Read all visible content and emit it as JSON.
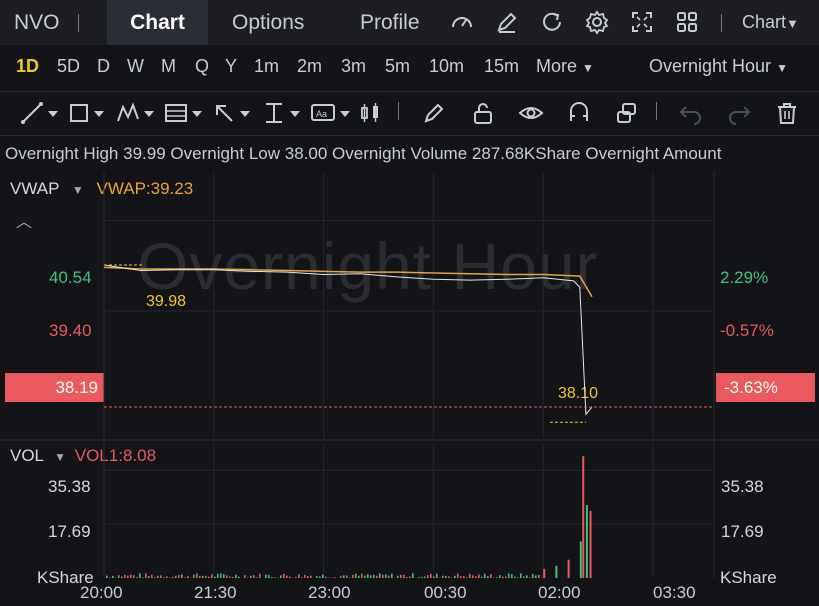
{
  "header": {
    "symbol": "NVO",
    "tabs": [
      "Chart",
      "Options",
      "Profile"
    ],
    "chart_menu": "Chart",
    "icons": [
      "speedometer-icon",
      "edit-icon",
      "refresh-icon",
      "settings-icon",
      "fullscreen-icon",
      "layout-grid-icon"
    ]
  },
  "timeframes": {
    "items": [
      "1D",
      "5D",
      "D",
      "W",
      "M",
      "Q",
      "Y",
      "1m",
      "2m",
      "3m",
      "5m",
      "10m",
      "15m"
    ],
    "more": "More",
    "session": "Overnight Hour",
    "active": "1D"
  },
  "info": {
    "high_label": "Overnight High",
    "high": "39.99",
    "low_label": "Overnight Low",
    "low": "38.00",
    "volume_label": "Overnight Volume",
    "volume": "287.68KShare",
    "amount_label": "Overnight Amount"
  },
  "price_panel": {
    "indicator": "VWAP",
    "indicator_value": "VWAP:39.23",
    "watermark": "Overnight Hour",
    "left_axis": [
      "40.54",
      "39.40",
      "38.19"
    ],
    "right_axis": [
      "2.29%",
      "-0.57%",
      "-3.63%"
    ],
    "high_marker": "39.98",
    "low_marker": "38.10"
  },
  "volume_panel": {
    "indicator": "VOL",
    "indicator_value": "VOL1:8.08",
    "left_axis": [
      "35.38",
      "17.69",
      "KShare"
    ],
    "right_axis": [
      "35.38",
      "17.69",
      "KShare"
    ]
  },
  "x_axis": [
    "20:00",
    "21:30",
    "23:00",
    "00:30",
    "02:00",
    "03:30"
  ],
  "colors": {
    "accent": "#f4c430",
    "up": "#3fc27c",
    "down": "#e9595d",
    "vwap": "#e8a33a",
    "background": "#131417"
  },
  "chart_data": {
    "type": "line",
    "series": [
      {
        "name": "VWAP",
        "x": [
          "20:00",
          "20:30",
          "21:00",
          "21:30",
          "22:00",
          "22:30",
          "23:00",
          "23:30",
          "00:00",
          "00:30",
          "01:00",
          "01:30",
          "02:00",
          "02:30",
          "02:40"
        ],
        "values": [
          39.95,
          39.93,
          39.93,
          39.93,
          39.92,
          39.91,
          39.9,
          39.89,
          39.89,
          39.88,
          39.87,
          39.86,
          39.86,
          39.84,
          39.58
        ]
      },
      {
        "name": "Price",
        "x": [
          "20:00",
          "20:30",
          "21:00",
          "21:30",
          "22:00",
          "22:30",
          "23:00",
          "23:30",
          "00:00",
          "00:30",
          "01:00",
          "01:30",
          "02:00",
          "02:25",
          "02:30",
          "02:35",
          "02:40"
        ],
        "values": [
          39.98,
          39.91,
          39.92,
          39.92,
          39.9,
          39.89,
          39.86,
          39.87,
          39.83,
          39.8,
          39.79,
          39.8,
          39.82,
          39.78,
          39.7,
          38.1,
          38.19
        ]
      }
    ],
    "volume": {
      "x": [
        "02:00",
        "02:10",
        "02:20",
        "02:30",
        "02:32",
        "02:35",
        "02:38"
      ],
      "values": [
        3,
        4,
        6,
        12,
        40,
        24,
        22
      ]
    },
    "ylim": [
      37.8,
      40.9
    ],
    "xlabel": "",
    "ylabel": ""
  }
}
